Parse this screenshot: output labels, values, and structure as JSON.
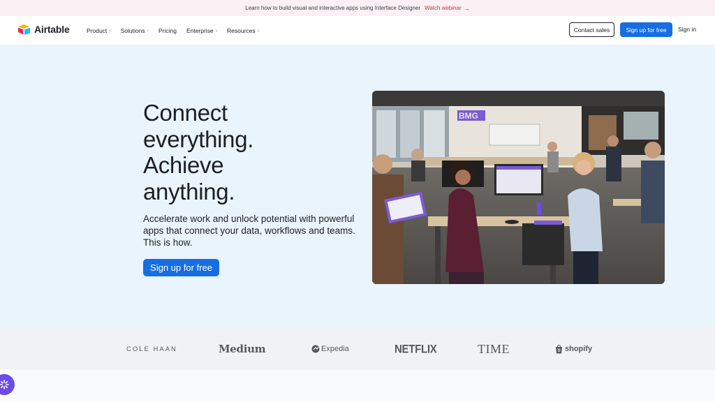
{
  "announcement": {
    "text": "Learn how to build visual and interactive apps using Interface Designer",
    "link_label": "Watch webinar",
    "arrow": "→"
  },
  "nav": {
    "logo_text": "Airtable",
    "logo_icon": "airtable-logo-icon",
    "links": [
      {
        "label": "Product",
        "has_chevron": true
      },
      {
        "label": "Solutions",
        "has_chevron": true
      },
      {
        "label": "Pricing",
        "has_chevron": false
      },
      {
        "label": "Enterprise",
        "has_chevron": true
      },
      {
        "label": "Resources",
        "has_chevron": true
      }
    ],
    "chevron": "›",
    "contact_sales": "Contact sales",
    "sign_up": "Sign up for free",
    "sign_in": "Sign in"
  },
  "hero": {
    "headline_lines": [
      "Connect",
      "everything.",
      "Achieve",
      "anything."
    ],
    "subheadline": "Accelerate work and unlock potential with powerful apps that connect your data, workflows and teams. This is how.",
    "cta": "Sign up for free",
    "photo_sign": "BMG"
  },
  "logos": {
    "brands": [
      "COLE HAAN",
      "Medium",
      "Expedia",
      "NETFLIX",
      "TIME",
      "shopify"
    ]
  },
  "colors": {
    "accent": "#166ee1",
    "hero_bg": "#eaf4fd",
    "announce_bg": "#fbf1f5",
    "logos_bg": "#f1f2f5",
    "fab": "#6b4ce6"
  },
  "fab_icon": "settings-burst-icon"
}
